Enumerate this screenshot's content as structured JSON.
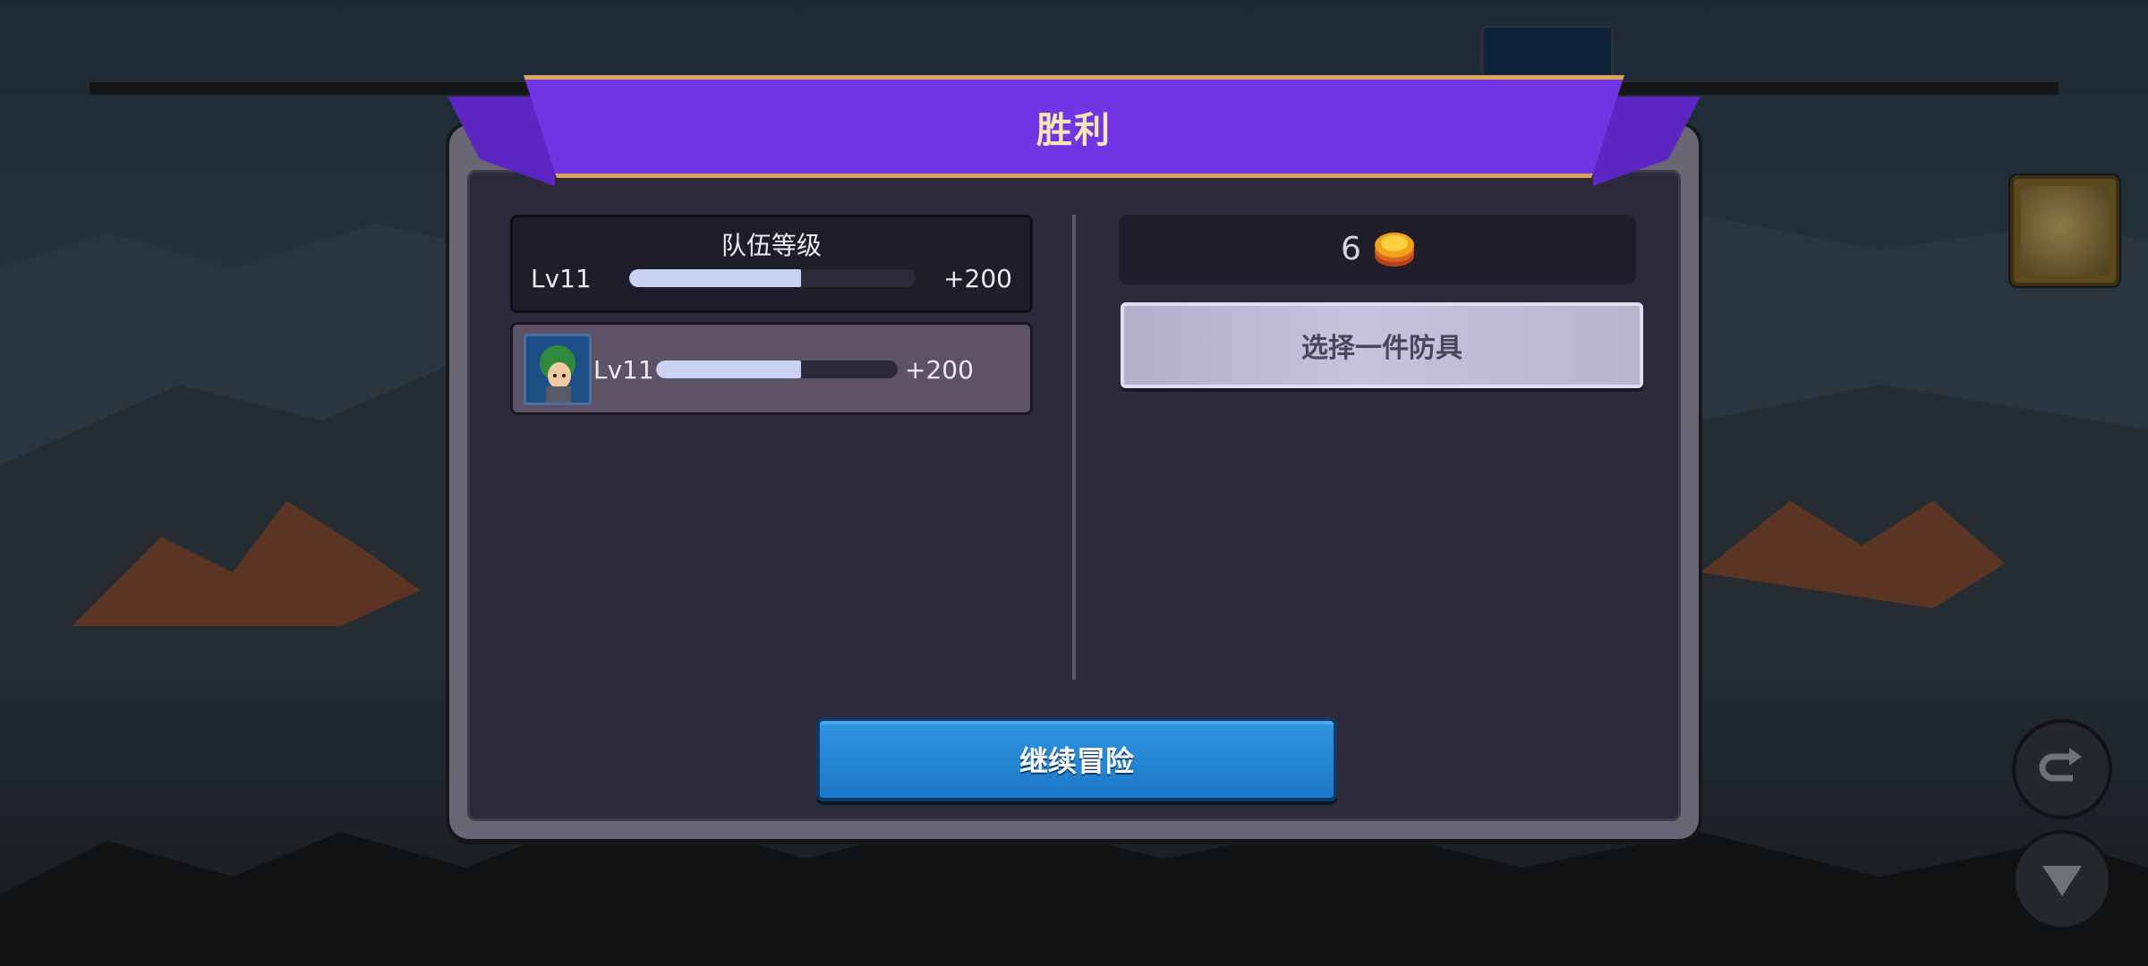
{
  "dialog": {
    "title": "胜利"
  },
  "team": {
    "title": "队伍等级",
    "level": "Lv11",
    "xp_gain": "+200",
    "progress": 0.6
  },
  "hero": {
    "level": "Lv11",
    "xp_gain": "+200",
    "progress": 0.6,
    "avatar_icon": "hero-portrait-icon"
  },
  "reward": {
    "count": "6",
    "icon": "gold-coin-icon",
    "choose_label": "选择一件防具"
  },
  "actions": {
    "continue_label": "继续冒险"
  },
  "colors": {
    "banner": "#7135e6",
    "continue_button": "#1c78c8",
    "choose_button": "#c9c2de",
    "progress_fill": "#c8d2f3"
  }
}
